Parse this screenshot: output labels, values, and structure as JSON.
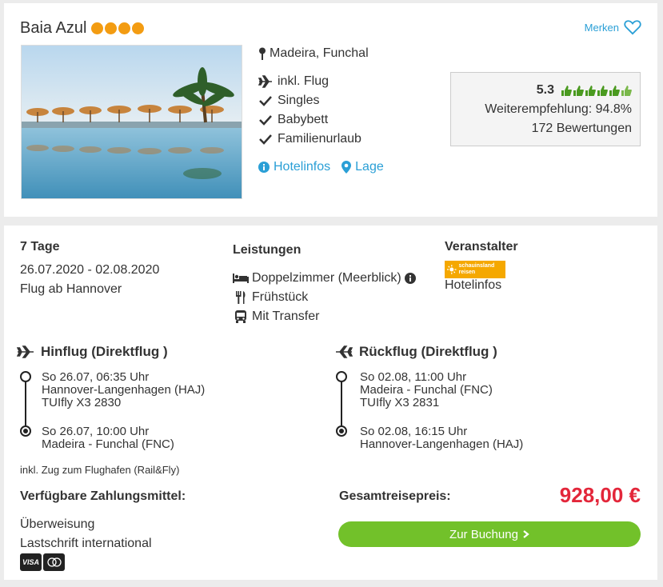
{
  "hotel": {
    "name": "Baia Azul",
    "star_count": 4,
    "star_color": "#f39c12",
    "location": "Madeira, Funchal",
    "features": [
      {
        "icon": "plane-icon",
        "label": "inkl. Flug"
      },
      {
        "icon": "check-icon",
        "label": "Singles"
      },
      {
        "icon": "check-icon",
        "label": "Babybett"
      },
      {
        "icon": "check-icon",
        "label": "Familienurlaub"
      }
    ],
    "links": {
      "hotelinfos": "Hotelinfos",
      "lage": "Lage"
    },
    "merken_label": "Merken"
  },
  "rating": {
    "score": "5.3",
    "thumbs_full": 6,
    "thumbs_total": 6,
    "recommendation": "Weiterempfehlung: 94.8%",
    "reviews": "172 Bewertungen"
  },
  "offer": {
    "duration": "7 Tage",
    "dates": "26.07.2020 - 02.08.2020",
    "departure": "Flug ab Hannover",
    "leistungen_title": "Leistungen",
    "leistungen": [
      {
        "icon": "bed-icon",
        "label": "Doppelzimmer (Meerblick)"
      },
      {
        "icon": "cutlery-icon",
        "label": "Frühstück"
      },
      {
        "icon": "bus-icon",
        "label": "Mit Transfer"
      }
    ],
    "veranstalter_title": "Veranstalter",
    "veranstalter_logo_text": "schauinsland reisen",
    "veranstalter_link": "Hotelinfos"
  },
  "hinflug": {
    "title": "Hinflug (Direktflug )",
    "dep_time": "So 26.07, 06:35 Uhr",
    "dep_airport": "Hannover-Langenhagen (HAJ)",
    "flight_no": "TUIfly X3 2830",
    "arr_time": "So 26.07, 10:00 Uhr",
    "arr_airport": "Madeira - Funchal (FNC)"
  },
  "rueckflug": {
    "title": "Rückflug (Direktflug )",
    "dep_time": "So 02.08, 11:00 Uhr",
    "dep_airport": "Madeira - Funchal (FNC)",
    "flight_no": "TUIfly X3 2831",
    "arr_time": "So 02.08, 16:15 Uhr",
    "arr_airport": "Hannover-Langenhagen (HAJ)"
  },
  "rail_note": "inkl. Zug zum Flughafen (Rail&Fly)",
  "payment": {
    "title": "Verfügbare Zahlungsmittel:",
    "methods": [
      "Überweisung",
      "Lastschrift international"
    ],
    "card_badges": [
      "VISA",
      "MC"
    ]
  },
  "total": {
    "label": "Gesamtreisepreis:",
    "price": "928,00 €",
    "price_color": "#e3263a"
  },
  "booking_button": "Zur Buchung"
}
